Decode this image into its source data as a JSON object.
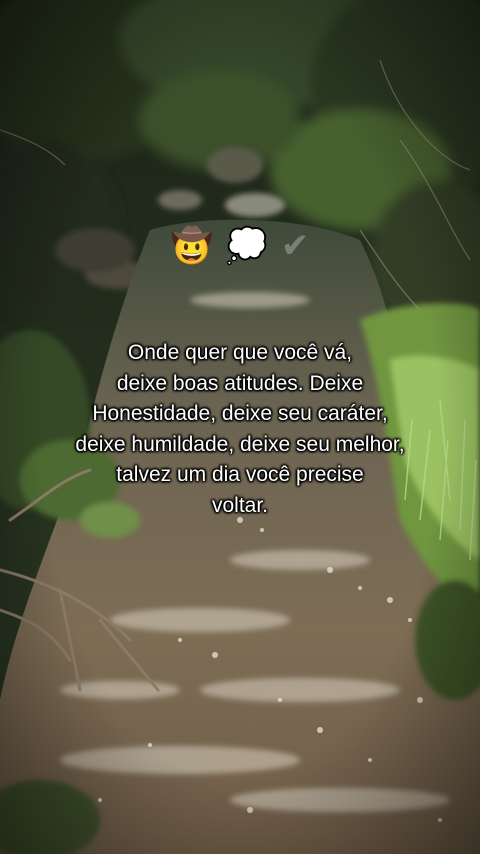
{
  "emojis": [
    {
      "char": "🤠",
      "icon": "cowboy-face-icon"
    },
    {
      "char": "💭",
      "icon": "thought-balloon-icon"
    },
    {
      "char": "✔",
      "icon": "check-mark-icon"
    }
  ],
  "quote": {
    "lines": [
      "Onde quer que você vá,",
      "deixe boas atitudes. Deixe",
      "Honestidade, deixe seu caráter,",
      "deixe humildade, deixe seu melhor,",
      "talvez um dia você precise",
      "voltar."
    ]
  },
  "colors": {
    "text": "#ffffff",
    "water": "#7b6a52",
    "foliage": "#4f6a33",
    "grass": "#8fb45a"
  }
}
